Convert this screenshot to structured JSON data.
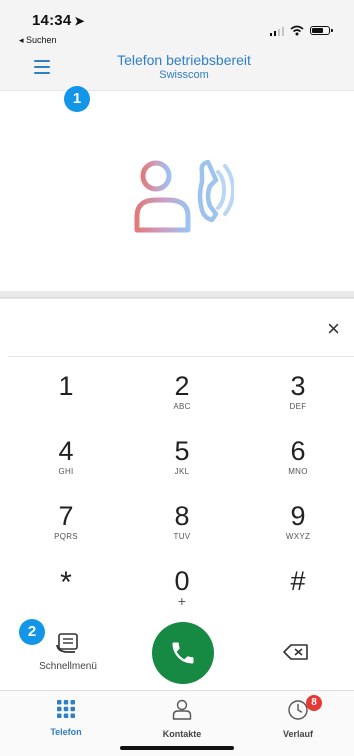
{
  "status_bar": {
    "time": "14:34",
    "back_label": "◂ Suchen"
  },
  "header": {
    "title": "Telefon betriebsbereit",
    "subtitle": "Swisscom"
  },
  "annotations": {
    "badge1": "1",
    "badge2": "2"
  },
  "dialpad": {
    "clear": "×",
    "keys": [
      {
        "digit": "1",
        "letters": ""
      },
      {
        "digit": "2",
        "letters": "ABC"
      },
      {
        "digit": "3",
        "letters": "DEF"
      },
      {
        "digit": "4",
        "letters": "GHI"
      },
      {
        "digit": "5",
        "letters": "JKL"
      },
      {
        "digit": "6",
        "letters": "MNO"
      },
      {
        "digit": "7",
        "letters": "PQRS"
      },
      {
        "digit": "8",
        "letters": "TUV"
      },
      {
        "digit": "9",
        "letters": "WXYZ"
      },
      {
        "digit": "*",
        "letters": ""
      },
      {
        "digit": "0",
        "letters": "+"
      },
      {
        "digit": "#",
        "letters": ""
      }
    ]
  },
  "actions": {
    "quick_menu_label": "Schnellmenü"
  },
  "tabs": [
    {
      "label": "Telefon",
      "icon": "dialpad-grid-icon",
      "active": true
    },
    {
      "label": "Kontakte",
      "icon": "person-icon",
      "active": false
    },
    {
      "label": "Verlauf",
      "icon": "clock-icon",
      "active": false,
      "badge": "8"
    }
  ],
  "colors": {
    "accent": "#2f7fc6",
    "call_green": "#168a43",
    "badge_blue": "#1496e8",
    "notification_red": "#e53935"
  }
}
